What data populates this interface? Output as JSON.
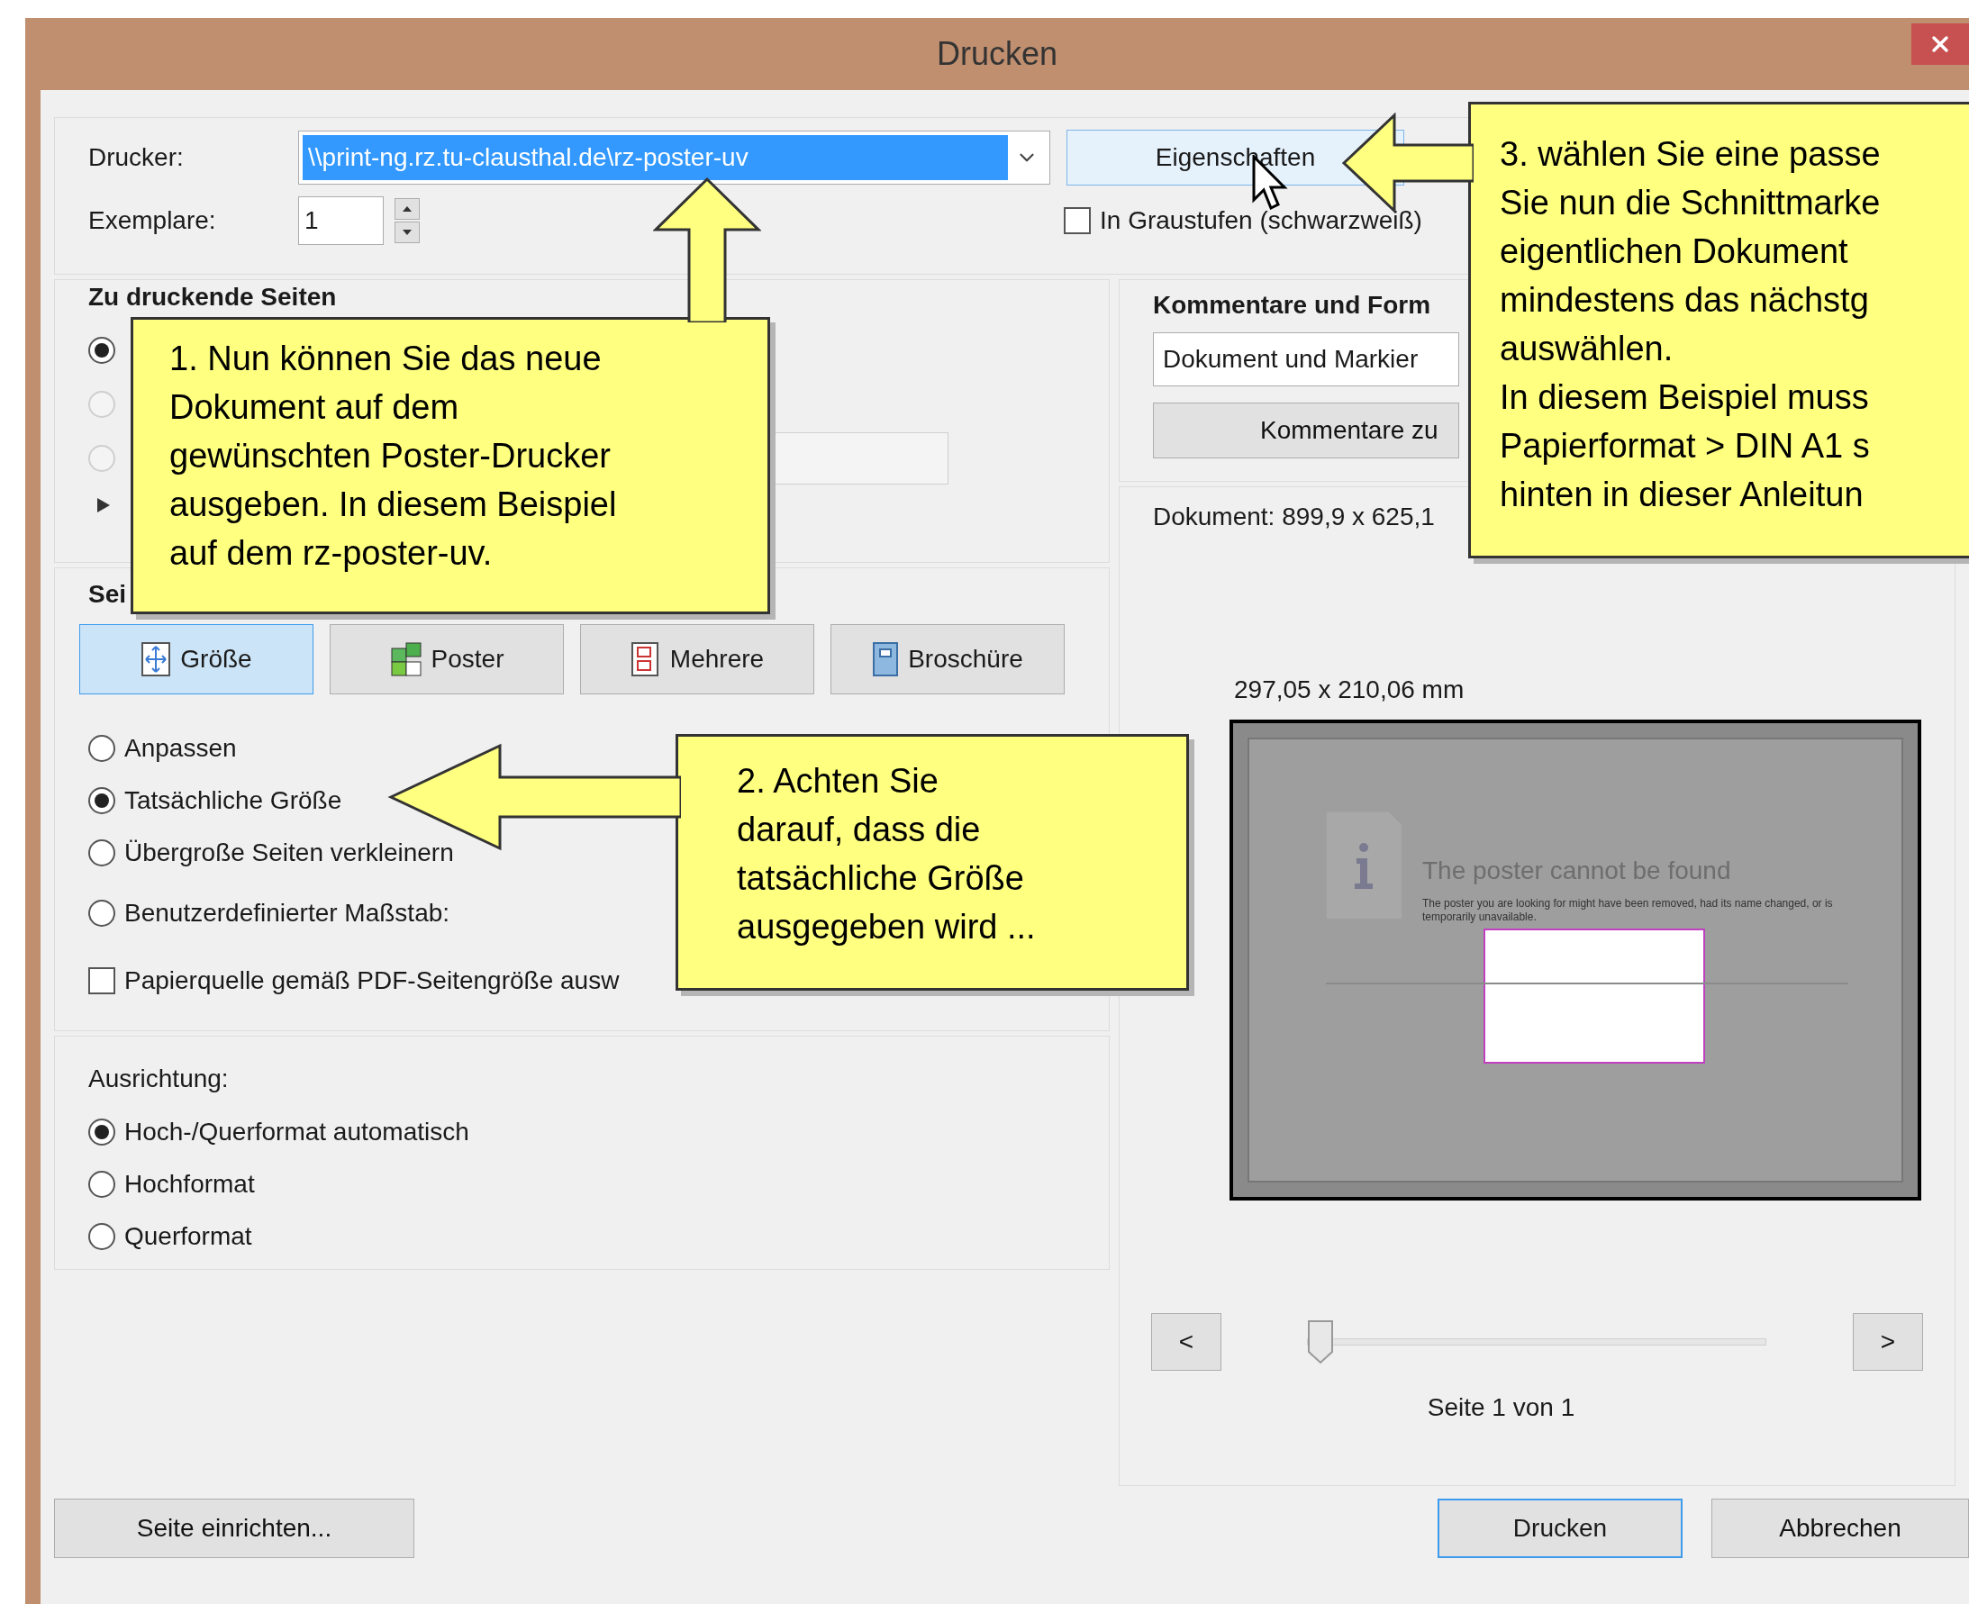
{
  "window": {
    "title": "Drucken"
  },
  "printer": {
    "label": "Drucker:",
    "value": "\\\\print-ng.rz.tu-clausthal.de\\rz-poster-uv",
    "properties_button": "Eigenschaften"
  },
  "copies": {
    "label": "Exemplare:",
    "value": "1"
  },
  "grayscale": {
    "label": "In Graustufen (schwarzweiß)",
    "checked": false
  },
  "pages_to_print": {
    "heading": "Zu druckende Seiten",
    "options": [
      {
        "selected": true,
        "disabled": false
      },
      {
        "selected": false,
        "disabled": true
      },
      {
        "selected": false,
        "disabled": true
      }
    ]
  },
  "page_sizing": {
    "heading": "Sei",
    "modes": [
      {
        "label": "Größe",
        "selected": true
      },
      {
        "label": "Poster",
        "selected": false
      },
      {
        "label": "Mehrere",
        "selected": false
      },
      {
        "label": "Broschüre",
        "selected": false
      }
    ],
    "options": [
      {
        "label": "Anpassen",
        "selected": false
      },
      {
        "label": "Tatsächliche Größe",
        "selected": true
      },
      {
        "label": "Übergroße Seiten verkleinern",
        "selected": false
      },
      {
        "label": "Benutzerdefinierter Maßstab:",
        "selected": false
      }
    ],
    "paper_source": {
      "label": "Papierquelle gemäß PDF-Seitengröße ausw",
      "checked": false
    }
  },
  "orientation": {
    "label": "Ausrichtung:",
    "options": [
      {
        "label": "Hoch-/Querformat automatisch",
        "selected": true
      },
      {
        "label": "Hochformat",
        "selected": false
      },
      {
        "label": "Querformat",
        "selected": false
      }
    ]
  },
  "comments": {
    "heading": "Kommentare und Form",
    "value": "Dokument und Markier",
    "summary_button": "Kommentare zu"
  },
  "document_size": "Dokument: 899,9 x 625,1",
  "preview": {
    "page_size": "297,05 x 210,06 mm",
    "title": "The poster cannot be found",
    "message": "The poster you are looking for might have been removed, had its name changed, or is temporarily unavailable.",
    "prev": "<",
    "next": ">",
    "slider": {
      "level": 0
    },
    "page_label": "Seite 1 von 1"
  },
  "buttons": {
    "setup": "Seite einrichten...",
    "print": "Drucken",
    "cancel": "Abbrechen"
  },
  "callouts": [
    {
      "text": "1. Nun können Sie das neue\nDokument auf dem\ngewünschten Poster-Drucker\nausgeben. In diesem Beispiel\nauf dem rz-poster-uv."
    },
    {
      "text": "2. Achten Sie\ndarauf, dass die\ntatsächliche Größe\nausgegeben wird ..."
    },
    {
      "text": "3. wählen Sie eine passe\nSie nun die Schnittmarke\neigentlichen Dokument\nmindestens das nächstg\nauswählen.\nIn diesem Beispiel muss\nPapierformat > DIN A1 s\nhinten in dieser Anleitun"
    }
  ]
}
